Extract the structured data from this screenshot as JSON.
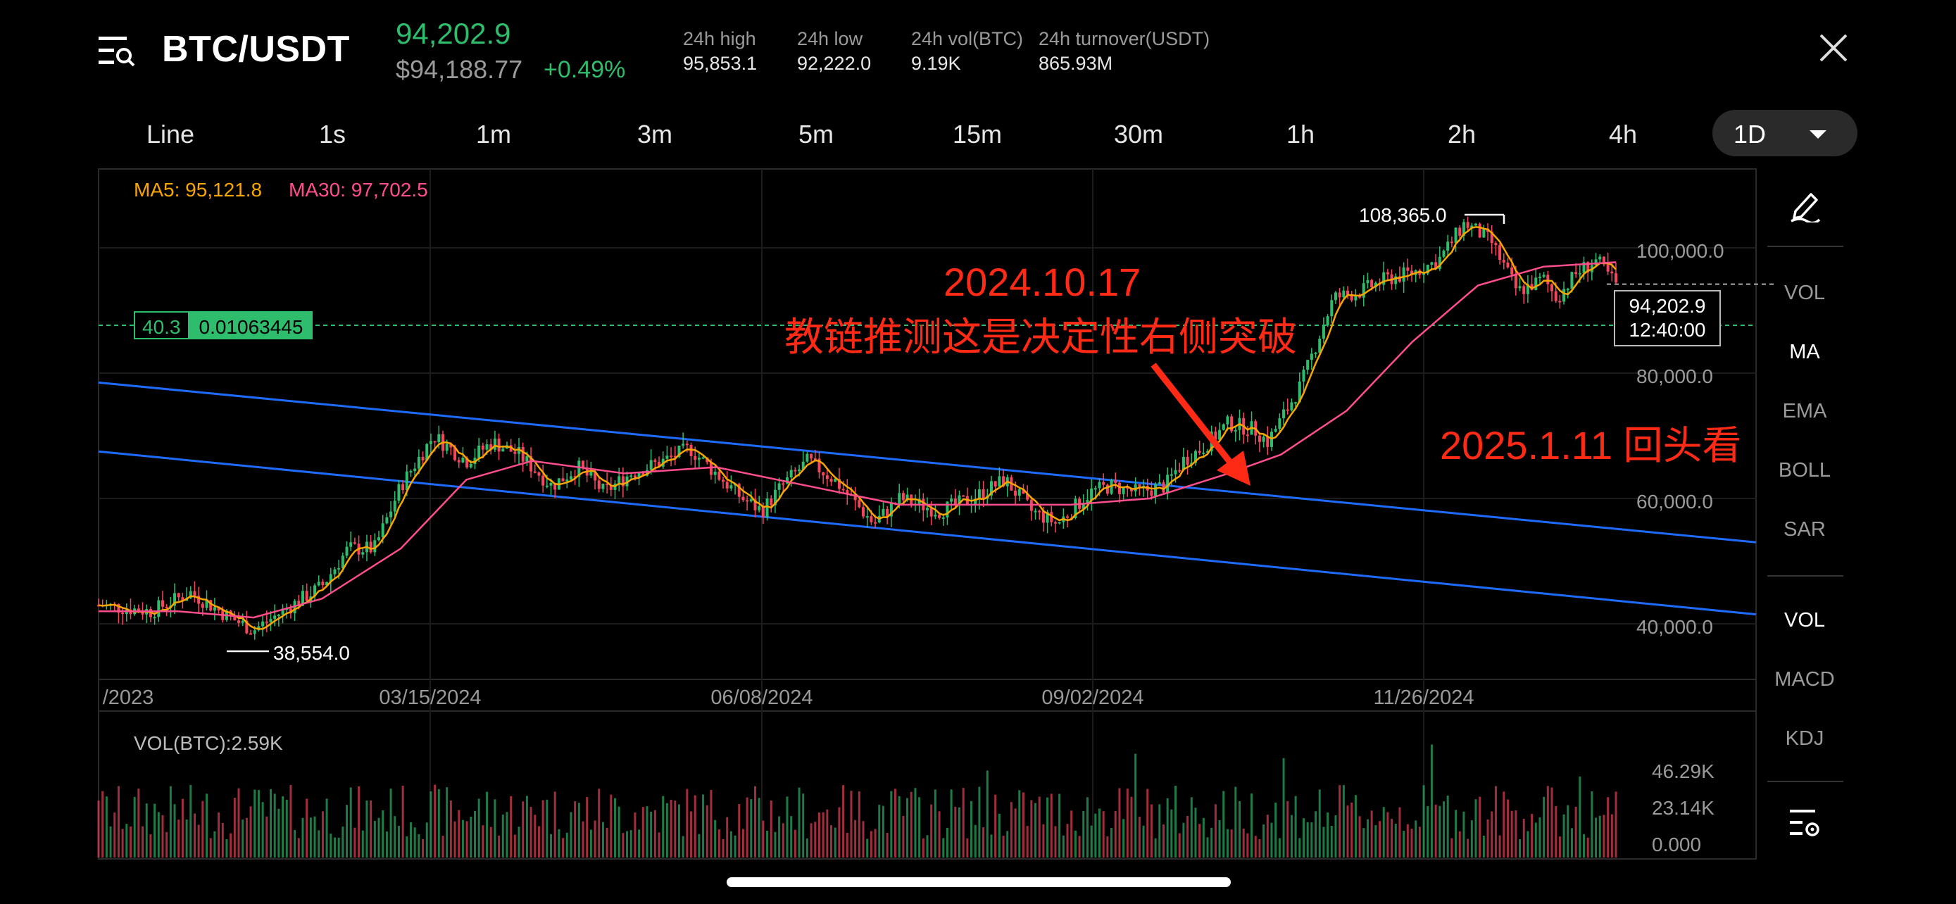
{
  "header": {
    "pair": "BTC/USDT",
    "last_price": "94,202.9",
    "usd_price": "$94,188.77",
    "change": "+0.49%",
    "stats": [
      {
        "label": "24h high",
        "value": "95,853.1"
      },
      {
        "label": "24h low",
        "value": "92,222.0"
      },
      {
        "label": "24h vol(BTC)",
        "value": "9.19K"
      },
      {
        "label": "24h turnover(USDT)",
        "value": "865.93M"
      }
    ]
  },
  "timeframes": [
    "Line",
    "1s",
    "1m",
    "3m",
    "5m",
    "15m",
    "30m",
    "1h",
    "2h",
    "4h"
  ],
  "active_timeframe": "1D",
  "indicators": {
    "ma5": "MA5: 95,121.8",
    "ma30": "MA30: 97,702.5"
  },
  "level_box": {
    "left": "40.3",
    "right": "0.01063445"
  },
  "y_axis": [
    "100,000.0",
    "80,000.0",
    "60,000.0",
    "40,000.0"
  ],
  "x_axis": [
    "/2023",
    "03/15/2024",
    "06/08/2024",
    "09/02/2024",
    "11/26/2024"
  ],
  "price_tag": {
    "price": "94,202.9",
    "countdown": "12:40:00"
  },
  "high_marker": "108,365.0",
  "low_marker": "38,554.0",
  "annotations": {
    "date": "2024.10.17",
    "text": "教链推测这是决定性右侧突破",
    "review": "2025.1.11 回头看"
  },
  "right_panel": {
    "main": [
      "VOL",
      "MA",
      "EMA",
      "BOLL",
      "SAR"
    ],
    "sub": [
      "VOL",
      "MACD",
      "KDJ"
    ]
  },
  "volume": {
    "label": "VOL(BTC):2.59K",
    "axis": [
      "46.29K",
      "23.14K",
      "0.000"
    ]
  },
  "colors": {
    "up": "#2ebd6d",
    "down": "#f6465d",
    "ma5": "#f7a600",
    "ma30": "#ff4d8d",
    "channel": "#1e6bff",
    "annotation": "#ff2a16"
  },
  "chart_data": {
    "type": "candlestick",
    "title": "BTC/USDT 1D",
    "x_range_labels": [
      "/2023",
      "03/15/2024",
      "06/08/2024",
      "09/02/2024",
      "11/26/2024"
    ],
    "ylim": [
      30000,
      112000
    ],
    "y_ticks": [
      40000,
      60000,
      80000,
      100000
    ],
    "close_path": [
      [
        0,
        43000
      ],
      [
        40,
        42000
      ],
      [
        70,
        45000
      ],
      [
        100,
        41000
      ],
      [
        118,
        39000
      ],
      [
        140,
        42000
      ],
      [
        170,
        46000
      ],
      [
        190,
        52000
      ],
      [
        210,
        52000
      ],
      [
        230,
        62000
      ],
      [
        255,
        70000
      ],
      [
        280,
        66000
      ],
      [
        300,
        69000
      ],
      [
        320,
        67000
      ],
      [
        345,
        62000
      ],
      [
        365,
        65000
      ],
      [
        385,
        61000
      ],
      [
        405,
        64000
      ],
      [
        430,
        66000
      ],
      [
        450,
        68000
      ],
      [
        470,
        64000
      ],
      [
        490,
        60000
      ],
      [
        505,
        58000
      ],
      [
        520,
        62000
      ],
      [
        540,
        66000
      ],
      [
        560,
        63000
      ],
      [
        590,
        56000
      ],
      [
        610,
        60000
      ],
      [
        640,
        58000
      ],
      [
        665,
        60000
      ],
      [
        690,
        63000
      ],
      [
        710,
        58000
      ],
      [
        730,
        56000
      ],
      [
        755,
        61000
      ],
      [
        770,
        62000
      ],
      [
        790,
        61000
      ],
      [
        812,
        62000
      ],
      [
        825,
        66000
      ],
      [
        840,
        68000
      ],
      [
        860,
        72000
      ],
      [
        880,
        71000
      ],
      [
        890,
        69000
      ],
      [
        915,
        78000
      ],
      [
        940,
        92000
      ],
      [
        960,
        93000
      ],
      [
        980,
        95000
      ],
      [
        1000,
        96000
      ],
      [
        1020,
        98000
      ],
      [
        1040,
        104000
      ],
      [
        1060,
        101000
      ],
      [
        1080,
        93000
      ],
      [
        1100,
        95000
      ],
      [
        1110,
        92000
      ],
      [
        1125,
        96000
      ],
      [
        1140,
        98000
      ],
      [
        1155,
        94202.9
      ]
    ],
    "ma30_path": [
      [
        0,
        42000
      ],
      [
        60,
        42000
      ],
      [
        118,
        41000
      ],
      [
        170,
        44000
      ],
      [
        230,
        52000
      ],
      [
        280,
        63000
      ],
      [
        330,
        66000
      ],
      [
        400,
        64000
      ],
      [
        470,
        65000
      ],
      [
        540,
        62000
      ],
      [
        610,
        59000
      ],
      [
        680,
        59000
      ],
      [
        740,
        59000
      ],
      [
        800,
        60000
      ],
      [
        860,
        64000
      ],
      [
        900,
        67000
      ],
      [
        950,
        74000
      ],
      [
        1000,
        85000
      ],
      [
        1050,
        94000
      ],
      [
        1100,
        97000
      ],
      [
        1155,
        97702.5
      ]
    ],
    "high": 108365.0,
    "low": 38554.0,
    "channel_upper": [
      [
        0,
        78500
      ],
      [
        1155,
        53000
      ]
    ],
    "channel_lower": [
      [
        0,
        67500
      ],
      [
        1155,
        41500
      ]
    ],
    "volume_max": 46290
  }
}
